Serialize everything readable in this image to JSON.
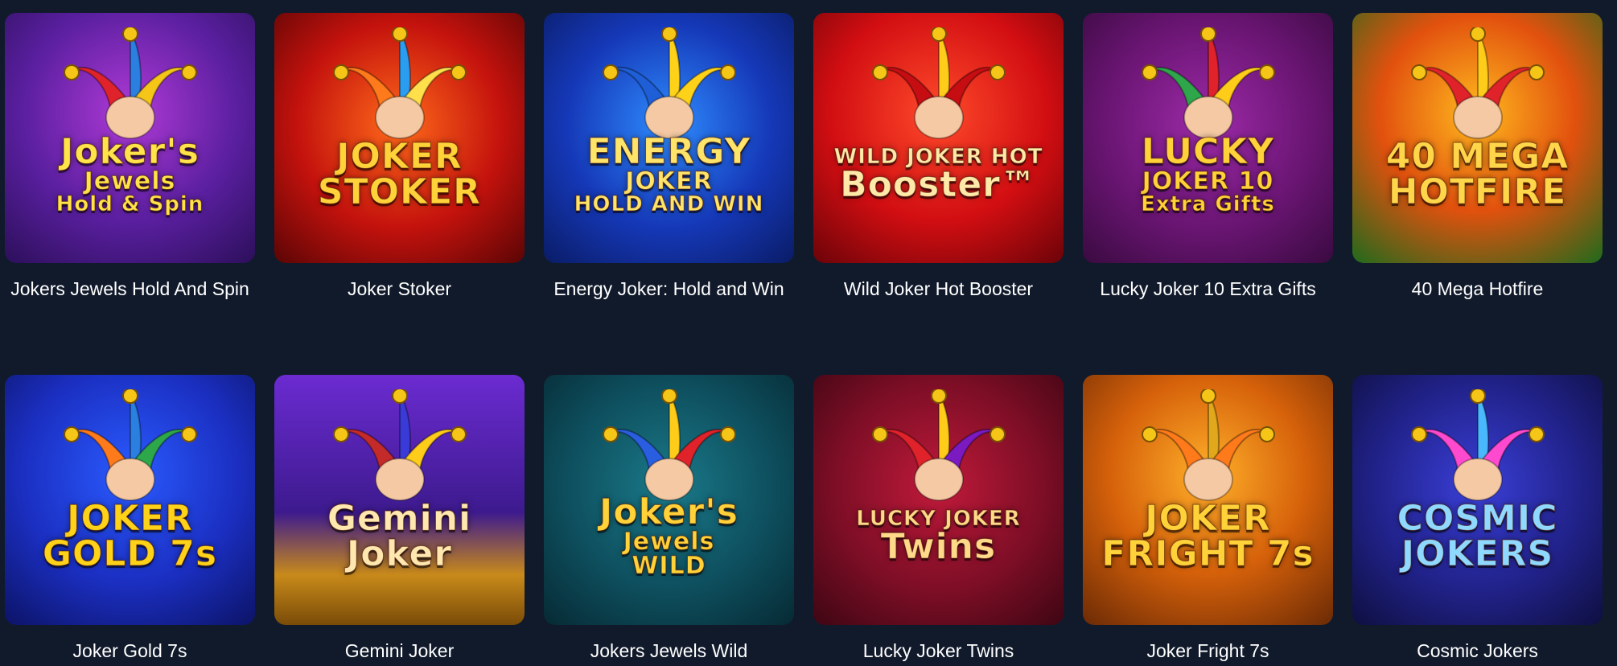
{
  "games": [
    {
      "title": "Jokers Jewels Hold And Spin",
      "logo_lines": [
        "Joker's",
        "Jewels",
        "Hold & Spin"
      ],
      "logo_color": "#ffe34a",
      "hat_colors": [
        "#e0222a",
        "#2a7fe0",
        "#f5c518"
      ]
    },
    {
      "title": "Joker Stoker",
      "logo_lines": [
        "JOKER",
        "STOKER"
      ],
      "logo_color": "#ffd23a",
      "hat_colors": [
        "#ff7a1a",
        "#2a9df0",
        "#ffe04a"
      ]
    },
    {
      "title": "Energy Joker: Hold and Win",
      "logo_lines": [
        "ENERGY",
        "JOKER",
        "HOLD AND WIN"
      ],
      "logo_color": "#ffe46a",
      "hat_colors": [
        "#1e5fd8",
        "#ffd21a",
        "#ffd21a"
      ]
    },
    {
      "title": "Wild Joker Hot Booster",
      "logo_lines": [
        "WILD JOKER HOT",
        "Booster™"
      ],
      "logo_color": "#ffe9a8",
      "hat_colors": [
        "#c50d12",
        "#ffcc1a",
        "#c50d12"
      ]
    },
    {
      "title": "Lucky Joker 10 Extra Gifts",
      "logo_lines": [
        "LUCKY",
        "JOKER 10",
        "Extra Gifts"
      ],
      "logo_color": "#ffd23a",
      "hat_colors": [
        "#2ea64a",
        "#e0222a",
        "#ffcc1a"
      ]
    },
    {
      "title": "40 Mega Hotfire",
      "logo_lines": [
        "40 MEGA",
        "HOTFIRE"
      ],
      "logo_color": "#ffd64a",
      "hat_colors": [
        "#e0222a",
        "#ffcc1a",
        "#e0222a"
      ]
    },
    {
      "title": "Joker Gold 7s",
      "logo_lines": [
        "JOKER",
        "GOLD 7s"
      ],
      "logo_color": "#ffd21a",
      "hat_colors": [
        "#ff7a1a",
        "#2a7fe0",
        "#2ea64a"
      ]
    },
    {
      "title": "Gemini Joker",
      "logo_lines": [
        "Gemini",
        "Joker"
      ],
      "logo_color": "#ffe8b0",
      "hat_colors": [
        "#c52a2a",
        "#3a3ad8",
        "#ffcc1a"
      ]
    },
    {
      "title": "Jokers Jewels Wild",
      "logo_lines": [
        "Joker's",
        "Jewels",
        "WILD"
      ],
      "logo_color": "#ffd23a",
      "hat_colors": [
        "#2a5ee0",
        "#ffcc1a",
        "#e0222a"
      ]
    },
    {
      "title": "Lucky Joker Twins",
      "logo_lines": [
        "LUCKY JOKER",
        "Twins"
      ],
      "logo_color": "#ffd98a",
      "hat_colors": [
        "#e0222a",
        "#ffcc1a",
        "#7a1ac0"
      ]
    },
    {
      "title": "Joker Fright 7s",
      "logo_lines": [
        "JOKER",
        "FRIGHT 7s"
      ],
      "logo_color": "#ffd23a",
      "hat_colors": [
        "#ff7a1a",
        "#e0a81a",
        "#ff7a1a"
      ]
    },
    {
      "title": "Cosmic Jokers",
      "logo_lines": [
        "COSMIC",
        "JOKERS"
      ],
      "logo_color": "#8fd8ff",
      "hat_colors": [
        "#ff4ad0",
        "#4ab8ff",
        "#ff4ad0"
      ]
    }
  ]
}
